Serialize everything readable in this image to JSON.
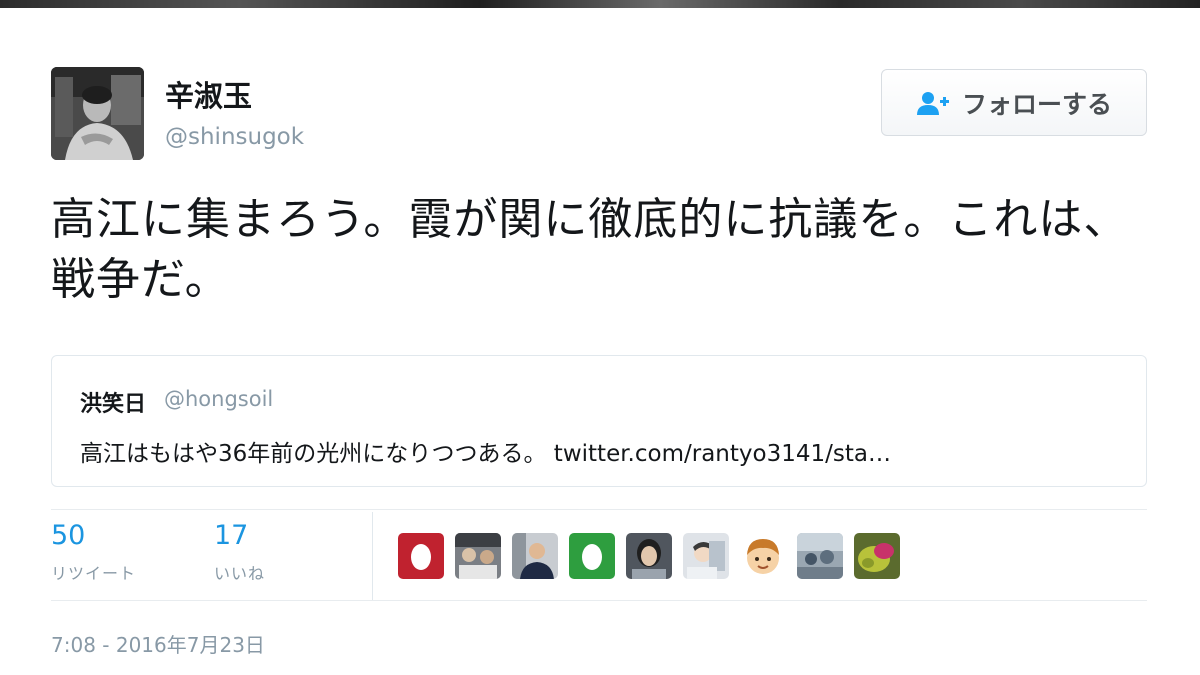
{
  "author": {
    "display_name": "辛淑玉",
    "screen_name": "@shinsugok",
    "avatar_icon": "user-photo-avatar"
  },
  "follow_button": {
    "label": "フォローする",
    "icon": "add-user-icon",
    "icon_color": "#1da1f2"
  },
  "tweet": {
    "text": "高江に集まろう。霞が関に徹底的に抗議を。これは、戦争だ。"
  },
  "quoted_tweet": {
    "display_name": "洪笑日",
    "screen_name": "@hongsoil",
    "text": "高江はもはや36年前の光州になりつつある。 twitter.com/rantyo3141/sta…"
  },
  "stats": {
    "retweets": {
      "count": "50",
      "label": "リツイート"
    },
    "likes": {
      "count": "17",
      "label": "いいね"
    },
    "count_color": "#1b95e0"
  },
  "likers": [
    {
      "icon": "default-egg-avatar-red"
    },
    {
      "icon": "user-photo-avatar"
    },
    {
      "icon": "user-photo-avatar"
    },
    {
      "icon": "default-egg-avatar-green"
    },
    {
      "icon": "user-photo-avatar"
    },
    {
      "icon": "user-photo-avatar"
    },
    {
      "icon": "cartoon-face-avatar"
    },
    {
      "icon": "user-photo-avatar"
    },
    {
      "icon": "user-photo-avatar"
    }
  ],
  "timestamp": "7:08 - 2016年7月23日"
}
